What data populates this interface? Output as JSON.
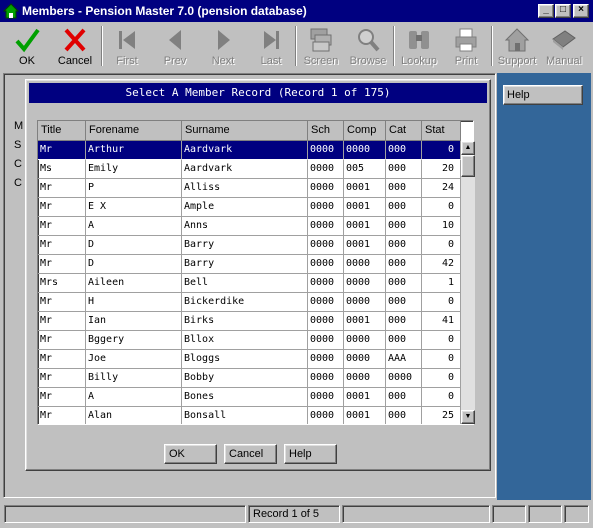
{
  "window": {
    "title": "Members - Pension Master 7.0 (pension database)",
    "minimize_glyph": "_",
    "maximize_glyph": "□",
    "close_glyph": "×"
  },
  "toolbar": {
    "buttons": [
      {
        "label": "OK",
        "icon": "check-icon",
        "enabled": true
      },
      {
        "label": "Cancel",
        "icon": "x-icon",
        "enabled": true
      },
      {
        "label": "First",
        "icon": "first-icon",
        "enabled": false
      },
      {
        "label": "Prev",
        "icon": "prev-icon",
        "enabled": false
      },
      {
        "label": "Next",
        "icon": "next-icon",
        "enabled": false
      },
      {
        "label": "Last",
        "icon": "last-icon",
        "enabled": false
      },
      {
        "label": "Screen",
        "icon": "screen-icon",
        "enabled": false
      },
      {
        "label": "Browse",
        "icon": "magnifier-icon",
        "enabled": false
      },
      {
        "label": "Lookup",
        "icon": "binoculars-icon",
        "enabled": false
      },
      {
        "label": "Print",
        "icon": "printer-icon",
        "enabled": false
      },
      {
        "label": "Support",
        "icon": "house-icon",
        "enabled": false
      },
      {
        "label": "Manual",
        "icon": "book-icon",
        "enabled": false
      }
    ]
  },
  "side_panel": {
    "help_label": "Help"
  },
  "background_form": {
    "letters": [
      "M",
      "S",
      "C",
      "C"
    ]
  },
  "dialog": {
    "title": "Select A Member Record (Record 1 of 175)",
    "columns": [
      "Title",
      "Forename",
      "Surname",
      "Sch",
      "Comp",
      "Cat",
      "Stat"
    ],
    "rows": [
      [
        "Mr",
        "Arthur",
        "Aardvark",
        "0000",
        "0000",
        "000",
        "0"
      ],
      [
        "Ms",
        "Emily",
        "Aardvark",
        "0000",
        "005",
        "000",
        "20"
      ],
      [
        "Mr",
        "P",
        "Alliss",
        "0000",
        "0001",
        "000",
        "24"
      ],
      [
        "Mr",
        "E X",
        "Ample",
        "0000",
        "0001",
        "000",
        "0"
      ],
      [
        "Mr",
        "A",
        "Anns",
        "0000",
        "0001",
        "000",
        "10"
      ],
      [
        "Mr",
        "D",
        "Barry",
        "0000",
        "0001",
        "000",
        "0"
      ],
      [
        "Mr",
        "D",
        "Barry",
        "0000",
        "0000",
        "000",
        "42"
      ],
      [
        "Mrs",
        "Aileen",
        "Bell",
        "0000",
        "0000",
        "000",
        "1"
      ],
      [
        "Mr",
        "H",
        "Bickerdike",
        "0000",
        "0000",
        "000",
        "0"
      ],
      [
        "Mr",
        "Ian",
        "Birks",
        "0000",
        "0001",
        "000",
        "41"
      ],
      [
        "Mr",
        "Bggery",
        "Bllox",
        "0000",
        "0000",
        "000",
        "0"
      ],
      [
        "Mr",
        "Joe",
        "Bloggs",
        "0000",
        "0000",
        "AAA",
        "0"
      ],
      [
        "Mr",
        "Billy",
        "Bobby",
        "0000",
        "0000",
        "0000",
        "0"
      ],
      [
        "Mr",
        "A",
        "Bones",
        "0000",
        "0001",
        "000",
        "0"
      ],
      [
        "Mr",
        "Alan",
        "Bonsall",
        "0000",
        "0001",
        "000",
        "25"
      ]
    ],
    "selected_row": 0,
    "scroll_position": 0.0,
    "buttons": {
      "ok": "OK",
      "cancel": "Cancel",
      "help": "Help"
    }
  },
  "statusbar": {
    "record_text": "Record 1 of 5"
  },
  "colors": {
    "titlebar": "#000080",
    "selection": "#000080",
    "side_panel": "#336699",
    "ok_check": "#00a000",
    "cancel_x": "#e00000"
  }
}
